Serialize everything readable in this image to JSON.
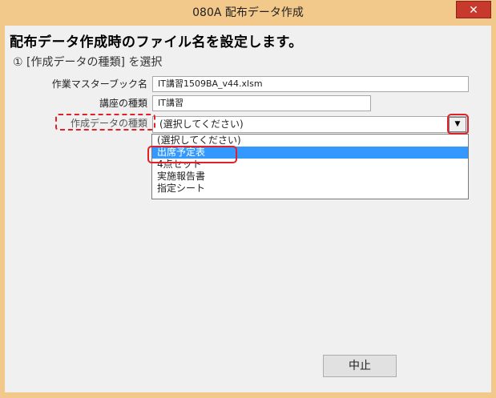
{
  "window": {
    "title": "080A 配布データ作成",
    "close_label": "✕"
  },
  "main": {
    "heading": "配布データ作成時のファイル名を設定します。",
    "step": "① [作成データの種類] を選択",
    "fields": [
      {
        "label": "作業マスターブック名",
        "value": "IT講習1509BA_v44.xlsm"
      },
      {
        "label": "講座の種類",
        "value": "IT講習"
      }
    ],
    "combo": {
      "label": "作成データの種類",
      "value": "(選択してください)",
      "options": [
        "(選択してください)",
        "出席予定表",
        "4点セット",
        "実施報告書",
        "指定シート"
      ],
      "selected_index": 1
    },
    "cancel_label": "中止"
  },
  "colors": {
    "titlebar": "#f3c88b",
    "close": "#c7392d",
    "selection": "#3399ff",
    "highlight": "#e0202a"
  }
}
